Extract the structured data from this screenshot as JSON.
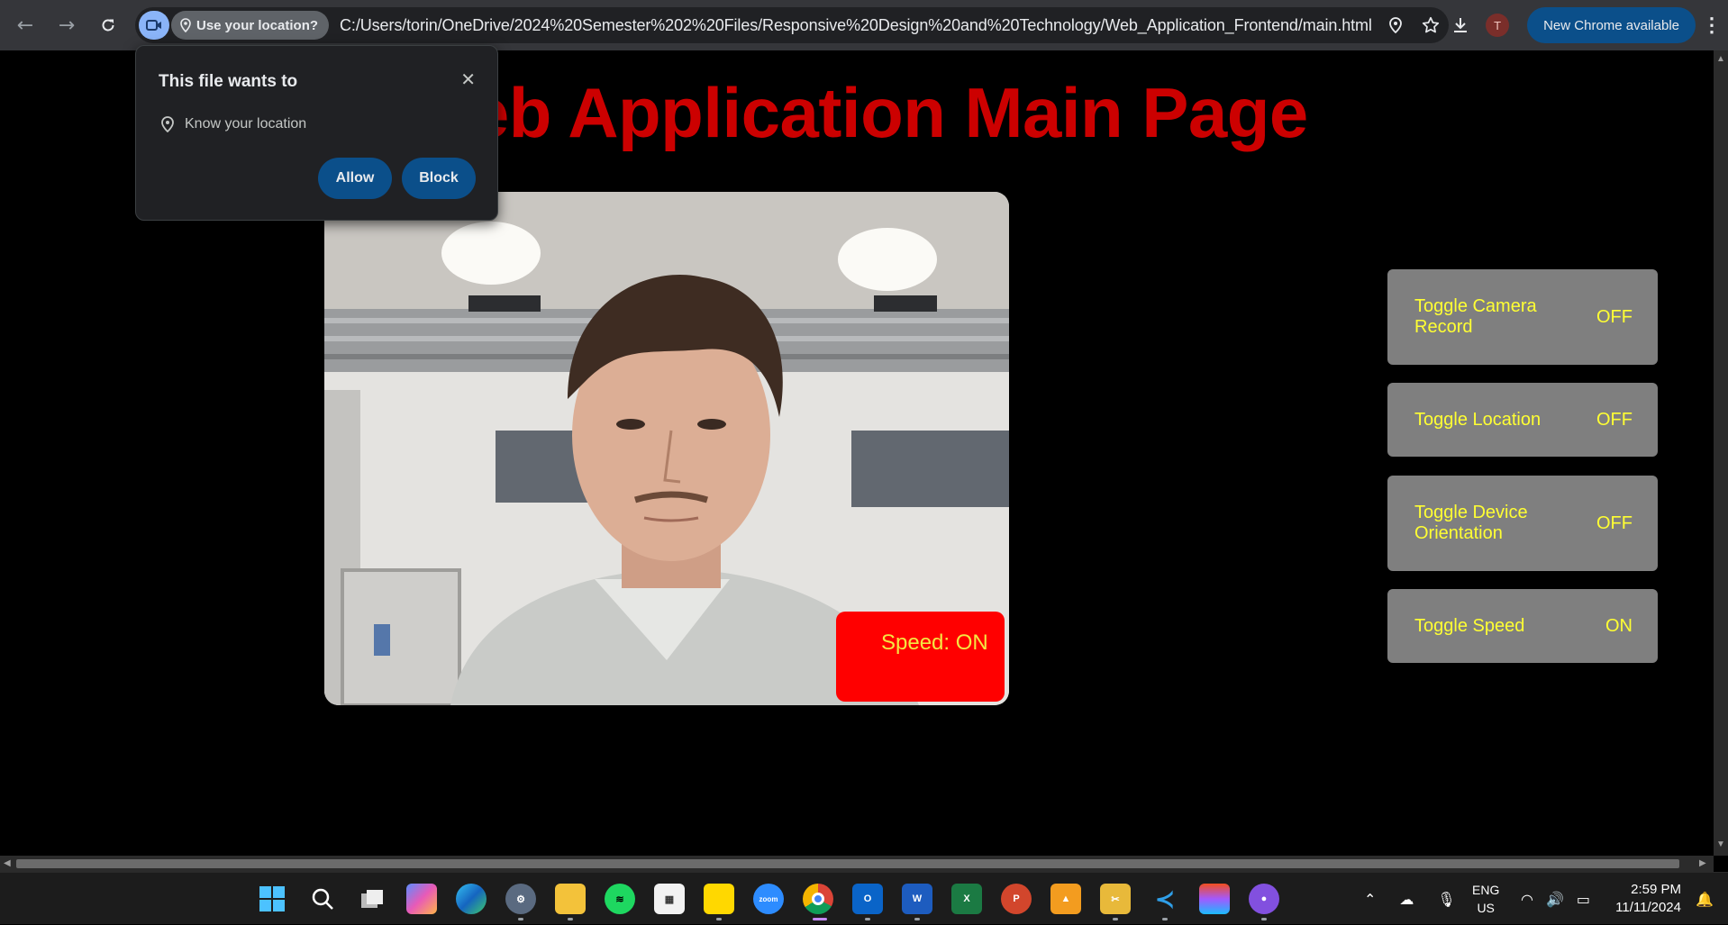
{
  "browser": {
    "back_icon": "arrow-left-icon",
    "forward_icon": "arrow-right-icon",
    "reload_icon": "reload-icon",
    "camera_chip_icon": "video-camera-icon",
    "location_chip_label": "Use your location?",
    "url": "C:/Users/torin/OneDrive/2024%20Semester%202%20Files/Responsive%20Design%20and%20Technology/Web_Application_Frontend/main.html",
    "avatar_initial": "T",
    "update_label": "New Chrome available"
  },
  "permission_popup": {
    "title": "This file wants to",
    "permission_text": "Know your location",
    "allow_label": "Allow",
    "block_label": "Block"
  },
  "page": {
    "title": "Web Application Main Page",
    "speed_badge": "Speed: ON",
    "toggles": [
      {
        "label": "Toggle Camera Record",
        "state": "OFF"
      },
      {
        "label": "Toggle Location",
        "state": "OFF"
      },
      {
        "label": "Toggle Device Orientation",
        "state": "OFF"
      },
      {
        "label": "Toggle Speed",
        "state": "ON"
      }
    ]
  },
  "taskbar": {
    "language_top": "ENG",
    "language_bottom": "US",
    "time": "2:59 PM",
    "date": "11/11/2024",
    "apps": [
      "start-icon",
      "search-icon",
      "task-view-icon",
      "copilot-icon",
      "edge-icon",
      "settings-icon",
      "file-explorer-icon",
      "spotify-icon",
      "microsoft-store-icon",
      "sticky-notes-icon",
      "zoom-icon",
      "chrome-icon",
      "outlook-icon",
      "word-icon",
      "excel-icon",
      "powerpoint-icon",
      "app-icon",
      "snipping-tool-icon",
      "vscode-icon",
      "figma-icon",
      "github-icon"
    ]
  },
  "colors": {
    "title_red": "#cc0000",
    "toggle_bg": "#7f7f7f",
    "toggle_text": "#ffff33",
    "speed_badge_bg": "#ff0000",
    "chrome_blue": "#0b4f8a"
  }
}
